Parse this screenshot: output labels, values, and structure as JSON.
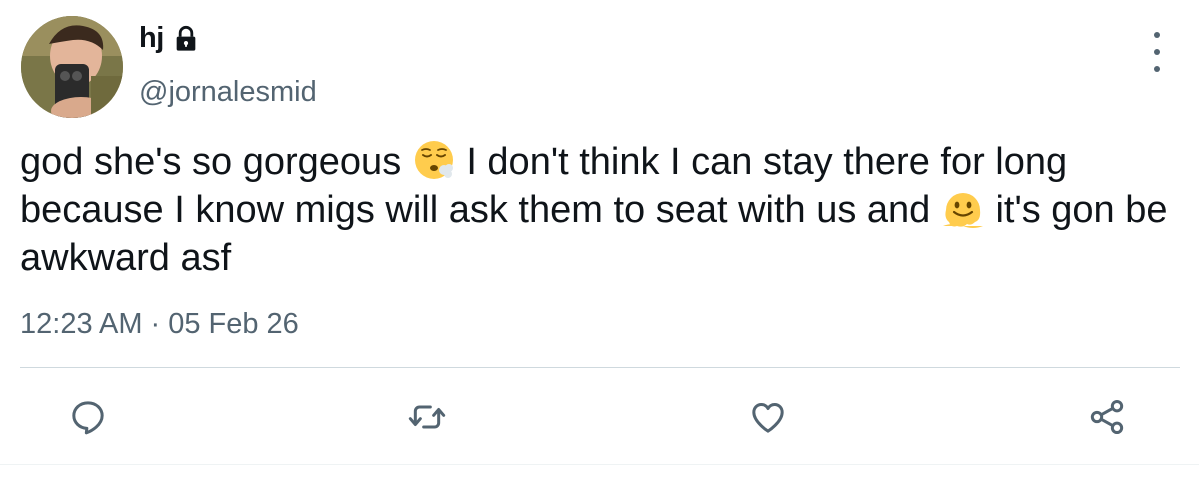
{
  "user": {
    "display_name": "hj",
    "handle": "@jornalesmid",
    "protected_icon": "lock-icon",
    "avatar": "avatar-photo"
  },
  "tweet": {
    "text_part_1": "god she's so gorgeous ",
    "emoji_1": "face-exhaling-emoji",
    "text_part_2": " I don't think I can stay there for long because I know migs will ask them to seat with us and ",
    "emoji_2": "melting-face-emoji",
    "text_part_3": " it's gon be awkward asf",
    "time": "12:23 AM",
    "separator": "·",
    "date": "05 Feb 26"
  },
  "actions": {
    "reply_icon": "reply-icon",
    "retweet_icon": "retweet-icon",
    "like_icon": "heart-icon",
    "share_icon": "share-icon",
    "more_icon": "more-vertical-icon"
  },
  "colors": {
    "text": "#0f1419",
    "secondary": "#536471",
    "divider": "#cfd9de",
    "emoji_yellow": "#ffcc4d"
  }
}
